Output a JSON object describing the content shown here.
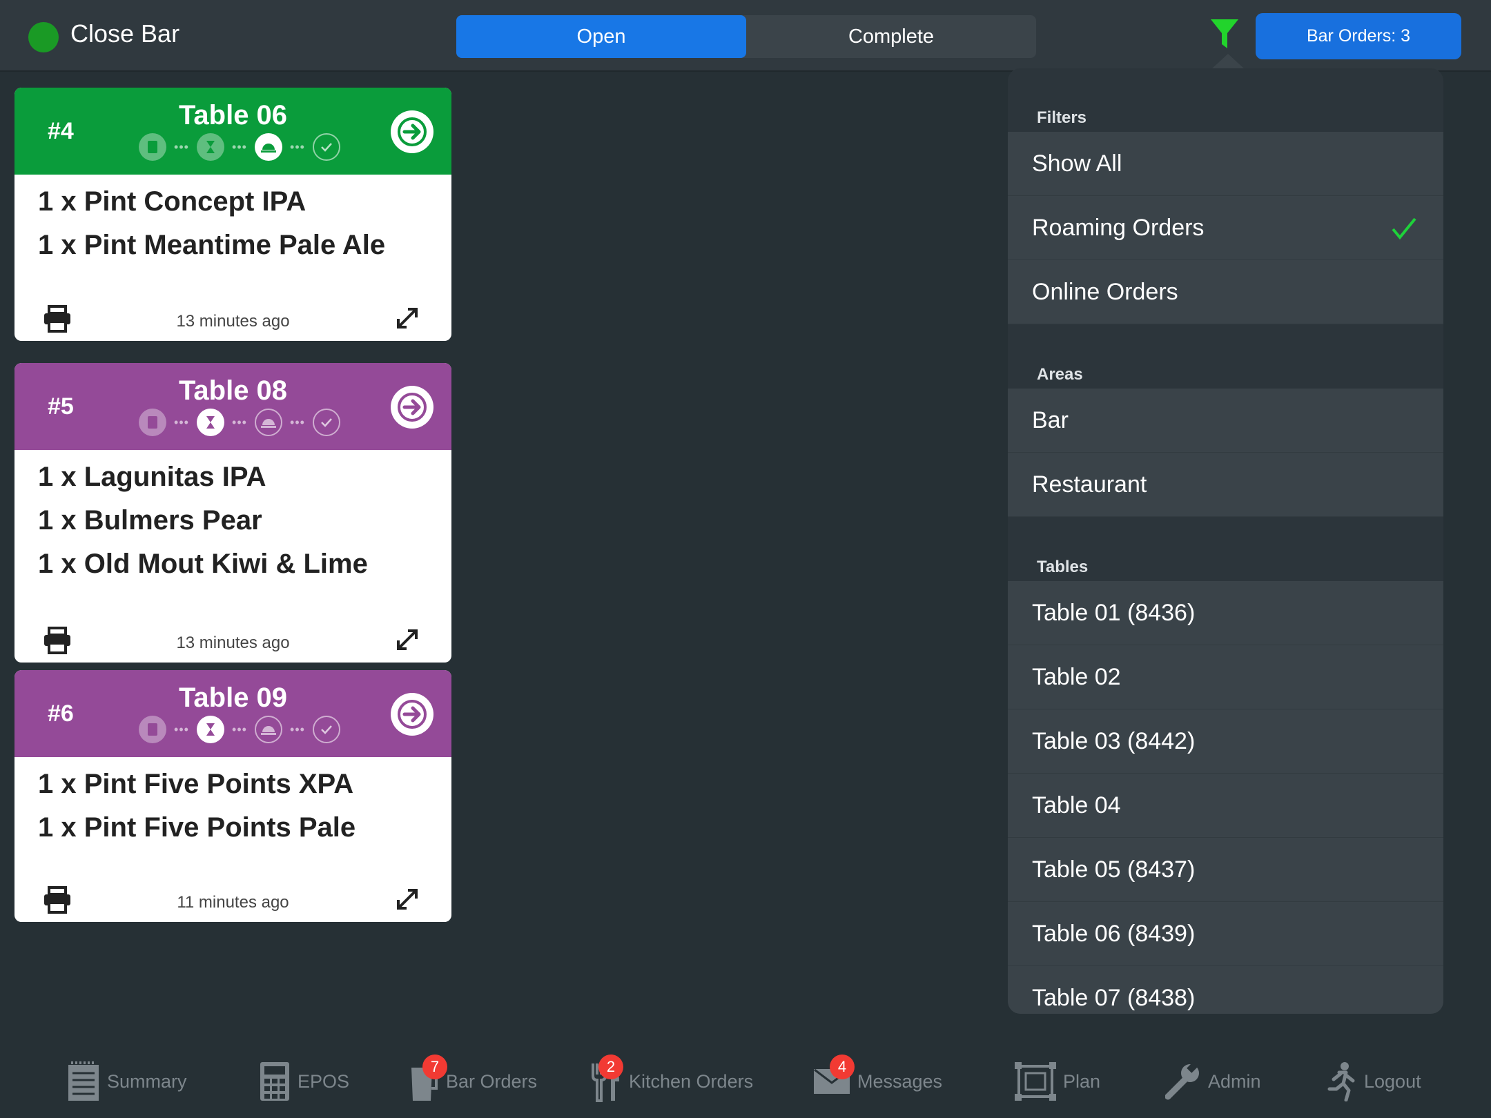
{
  "header": {
    "close_bar_label": "Close Bar",
    "status_color": "#1a9a25",
    "tabs": [
      {
        "label": "Open",
        "active": true
      },
      {
        "label": "Complete",
        "active": false
      }
    ],
    "bar_orders_label": "Bar Orders: 3",
    "filter_icon": "funnel-icon"
  },
  "orders": [
    {
      "number": "#4",
      "table": "Table 06",
      "color": "#0a9c3b",
      "current_step": 3,
      "items": [
        "1 x Pint Concept IPA",
        "1 x Pint Meantime Pale Ale"
      ],
      "time": "13 minutes ago"
    },
    {
      "number": "#5",
      "table": "Table 08",
      "color": "#944a98",
      "current_step": 2,
      "items": [
        "1 x Lagunitas IPA",
        "1 x Bulmers Pear",
        "1 x Old Mout Kiwi & Lime"
      ],
      "time": "13 minutes ago"
    },
    {
      "number": "#6",
      "table": "Table 09",
      "color": "#944a98",
      "current_step": 2,
      "items": [
        "1 x Pint Five Points XPA",
        "1 x Pint Five Points Pale"
      ],
      "time": "11 minutes ago"
    }
  ],
  "filters_panel": {
    "filters_header": "Filters",
    "filters": [
      {
        "label": "Show All",
        "checked": false
      },
      {
        "label": "Roaming Orders",
        "checked": true
      },
      {
        "label": "Online Orders",
        "checked": false
      }
    ],
    "areas_header": "Areas",
    "areas": [
      "Bar",
      "Restaurant"
    ],
    "tables_header": "Tables",
    "tables": [
      "Table 01 (8436)",
      "Table 02",
      "Table 03 (8442)",
      "Table 04",
      "Table 05 (8437)",
      "Table 06 (8439)",
      "Table 07 (8438)"
    ],
    "check_color": "#1ed23a"
  },
  "tabbar": [
    {
      "label": "Summary",
      "icon": "summary-icon"
    },
    {
      "label": "EPOS",
      "icon": "calculator-icon"
    },
    {
      "label": "Bar Orders",
      "icon": "glass-icon",
      "badge": "7"
    },
    {
      "label": "Kitchen Orders",
      "icon": "cutlery-icon",
      "badge": "2"
    },
    {
      "label": "Messages",
      "icon": "envelope-icon",
      "badge": "4"
    },
    {
      "label": "Plan",
      "icon": "floor-plan-icon"
    },
    {
      "label": "Admin",
      "icon": "wrench-icon"
    },
    {
      "label": "Logout",
      "icon": "running-man-icon"
    }
  ]
}
